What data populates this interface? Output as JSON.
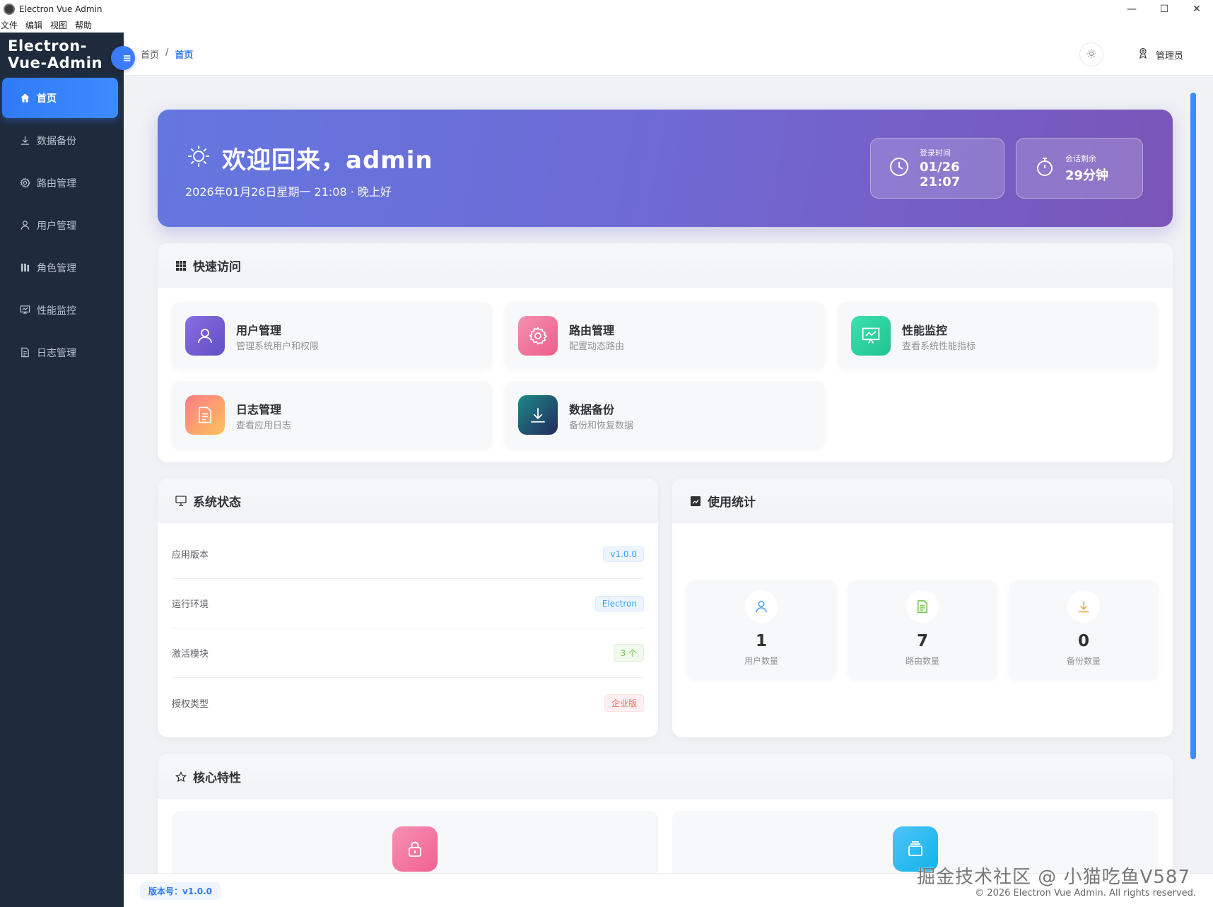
{
  "window": {
    "title": "Electron Vue Admin",
    "controls": [
      "—",
      "☐",
      "✕"
    ]
  },
  "menubar": [
    "文件",
    "编辑",
    "视图",
    "帮助"
  ],
  "sidebar": {
    "brand": "Electron-Vue-Admin",
    "collapse_icon": "≡",
    "items": [
      {
        "label": "首页",
        "icon": "home-icon",
        "active": true
      },
      {
        "label": "数据备份",
        "icon": "download-icon"
      },
      {
        "label": "路由管理",
        "icon": "gear-icon"
      },
      {
        "label": "用户管理",
        "icon": "user-icon"
      },
      {
        "label": "角色管理",
        "icon": "role-icon"
      },
      {
        "label": "性能监控",
        "icon": "monitor-chart-icon"
      },
      {
        "label": "日志管理",
        "icon": "document-icon"
      }
    ]
  },
  "header": {
    "breadcrumb": [
      "首页",
      "/",
      "首页"
    ],
    "user": "管理员"
  },
  "welcome": {
    "title": "欢迎回来，admin",
    "date": "2026年01月26日星期一 21:08 · 晚上好",
    "login_label": "登录时间",
    "login_value": "01/26 21:07",
    "session_label": "会话剩余",
    "session_value": "29分钟"
  },
  "quick_access": {
    "title": "快速访问",
    "items": [
      {
        "title": "用户管理",
        "desc": "管理系统用户和权限",
        "icon": "user-icon",
        "color": "#7e5fd1"
      },
      {
        "title": "路由管理",
        "desc": "配置动态路由",
        "icon": "gear-icon",
        "color": "#f06292"
      },
      {
        "title": "性能监控",
        "desc": "查看系统性能指标",
        "icon": "monitor-chart-icon",
        "color": "#2fd6a0"
      },
      {
        "title": "日志管理",
        "desc": "查看应用日志",
        "icon": "document-icon",
        "color": "#fb8c6a"
      },
      {
        "title": "数据备份",
        "desc": "备份和恢复数据",
        "icon": "download-icon",
        "color": "#1e4a73"
      }
    ]
  },
  "system_status": {
    "title": "系统状态",
    "rows": [
      {
        "label": "应用版本",
        "value": "v1.0.0",
        "tag": "blue"
      },
      {
        "label": "运行环境",
        "value": "Electron",
        "tag": "blue"
      },
      {
        "label": "激活模块",
        "value": "3 个",
        "tag": "green"
      },
      {
        "label": "授权类型",
        "value": "企业版",
        "tag": "red"
      }
    ]
  },
  "usage": {
    "title": "使用统计",
    "stats": [
      {
        "value": "1",
        "label": "用户数量",
        "icon": "user-icon"
      },
      {
        "value": "7",
        "label": "路由数量",
        "icon": "document-icon"
      },
      {
        "value": "0",
        "label": "备份数量",
        "icon": "download-icon"
      }
    ]
  },
  "features": {
    "title": "核心特性",
    "items": [
      {
        "icon": "lock-icon",
        "color": "#f06aa0"
      },
      {
        "icon": "layers-icon",
        "color": "#29b6f6"
      }
    ]
  },
  "footer": {
    "version": "版本号：v1.0.0",
    "watermark": "掘金技术社区 @ 小猫吃鱼V587",
    "copyright": "© 2026 Electron Vue Admin. All rights reserved."
  }
}
